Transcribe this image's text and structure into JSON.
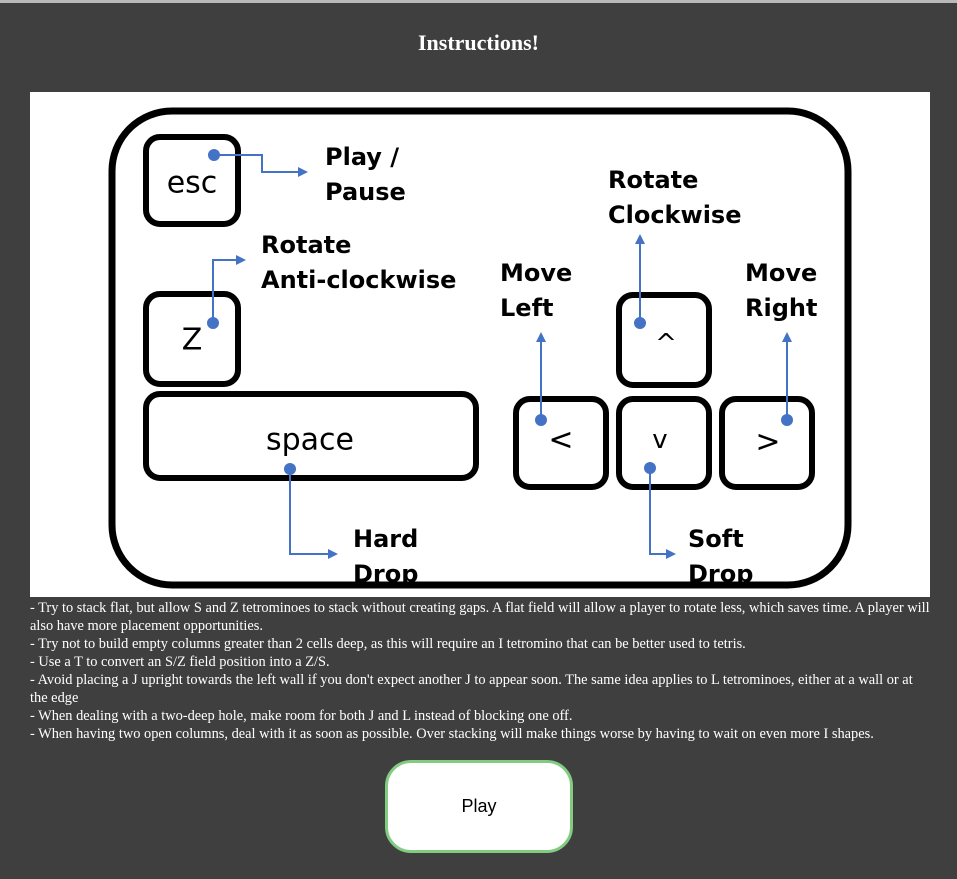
{
  "page": {
    "heading": "Instructions!"
  },
  "diagram": {
    "keys": {
      "esc": "esc",
      "z": "Z",
      "space": "space",
      "left": "<",
      "up": "^",
      "down": "v",
      "right": ">"
    },
    "labels": {
      "play_pause": [
        "Play /",
        "Pause"
      ],
      "rotate_anticlockwise": [
        "Rotate",
        "Anti-clockwise"
      ],
      "rotate_clockwise": [
        "Rotate",
        "Clockwise"
      ],
      "move_left": [
        "Move",
        "Left"
      ],
      "move_right": [
        "Move",
        "Right"
      ],
      "hard_drop": [
        "Hard",
        "Drop"
      ],
      "soft_drop": [
        "Soft",
        "Drop"
      ]
    },
    "colors": {
      "arrow": "#4472c4",
      "border": "#000000"
    }
  },
  "tips": [
    "- Try to stack flat, but allow S and Z tetrominoes to stack without creating gaps. A flat field will allow a player to rotate less, which saves time. A player will also have more placement opportunities.",
    "- Try not to build empty columns greater than 2 cells deep, as this will require an I tetromino that can be better used to tetris.",
    "- Use a T to convert an S/Z field position into a Z/S.",
    "- Avoid placing a J upright towards the left wall if you don't expect another J to appear soon. The same idea applies to L tetrominoes, either at a wall or at the edge",
    "- When dealing with a two-deep hole, make room for both J and L instead of blocking one off.",
    "- When having two open columns, deal with it as soon as possible. Over stacking will make things worse by having to wait on even more I shapes."
  ],
  "actions": {
    "play_label": "Play"
  }
}
